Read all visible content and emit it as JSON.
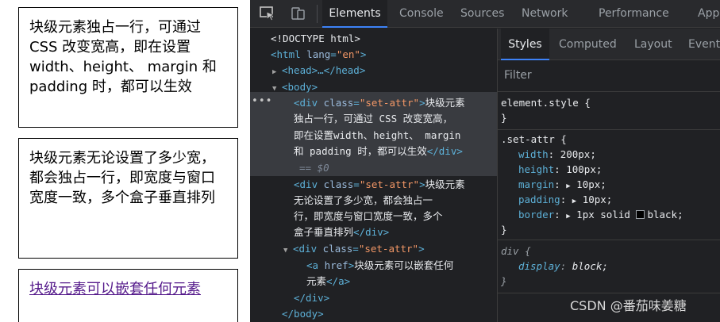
{
  "page": {
    "box1": "块级元素独占一行，可通过 CSS 改变宽高，即在设置 width、height、 margin 和 padding 时，都可以生效",
    "box2": "块级元素无论设置了多少宽，都会独占一行，即宽度与窗口宽度一致，多个盒子垂直排列",
    "box3_link": "块级元素可以嵌套任何元素"
  },
  "devtools": {
    "main_tabs": [
      "Elements",
      "Console",
      "Sources",
      "Network",
      "Performance",
      "App"
    ],
    "active_main_tab": "Elements",
    "elements": {
      "doctype": "<!DOCTYPE html>",
      "html_open": "<html",
      "html_attr": "lang",
      "html_val": "\"en\"",
      "head_line": "<head>…</head>",
      "body_open": "<body>",
      "div_open": "<div",
      "class_attr": "class",
      "class_val": "\"set-attr\"",
      "gt": ">",
      "div1_text_1": "块级元素",
      "div1_text_2": "独占一行，可通过 CSS 改变宽高，",
      "div1_text_3": "即在设置width、height、 margin",
      "div1_text_4": "和 padding 时，都可以生效",
      "div_close": "</div>",
      "eq0": "== $0",
      "div2_text_1": "块级元素",
      "div2_text_2": "无论设置了多少宽，都会独占一",
      "div2_text_3": "行，即宽度与窗口宽度一致，多个",
      "div2_text_4": "盒子垂直排列",
      "a_open": "<a",
      "a_attr": "href",
      "a_text_1": "块级元素可以嵌套任何",
      "a_text_2": "元素",
      "a_close": "</a>",
      "body_close": "</body>"
    },
    "styles": {
      "tabs": [
        "Styles",
        "Computed",
        "Layout",
        "Event"
      ],
      "active_tab": "Styles",
      "filter_placeholder": "Filter",
      "element_style_selector": "element.style {",
      "brace_close": "}",
      "rule_selector": ".set-attr {",
      "props": [
        {
          "name": "width",
          "value": "200px;"
        },
        {
          "name": "height",
          "value": "100px;"
        },
        {
          "name": "margin",
          "value": "10px;"
        },
        {
          "name": "padding",
          "value": "10px;"
        },
        {
          "name": "border",
          "value": "1px solid",
          "value2": "black;"
        }
      ],
      "ua_selector": "div {",
      "ua_prop": {
        "name": "display",
        "value": "block;"
      }
    },
    "colors": {
      "panel_bg": "#202124",
      "tab_bar_bg": "#292a2d",
      "accent": "#3d82f7",
      "tag": "#5db0d7",
      "attr_value": "#f29766"
    }
  },
  "watermark": "CSDN @番茄味姜糖"
}
